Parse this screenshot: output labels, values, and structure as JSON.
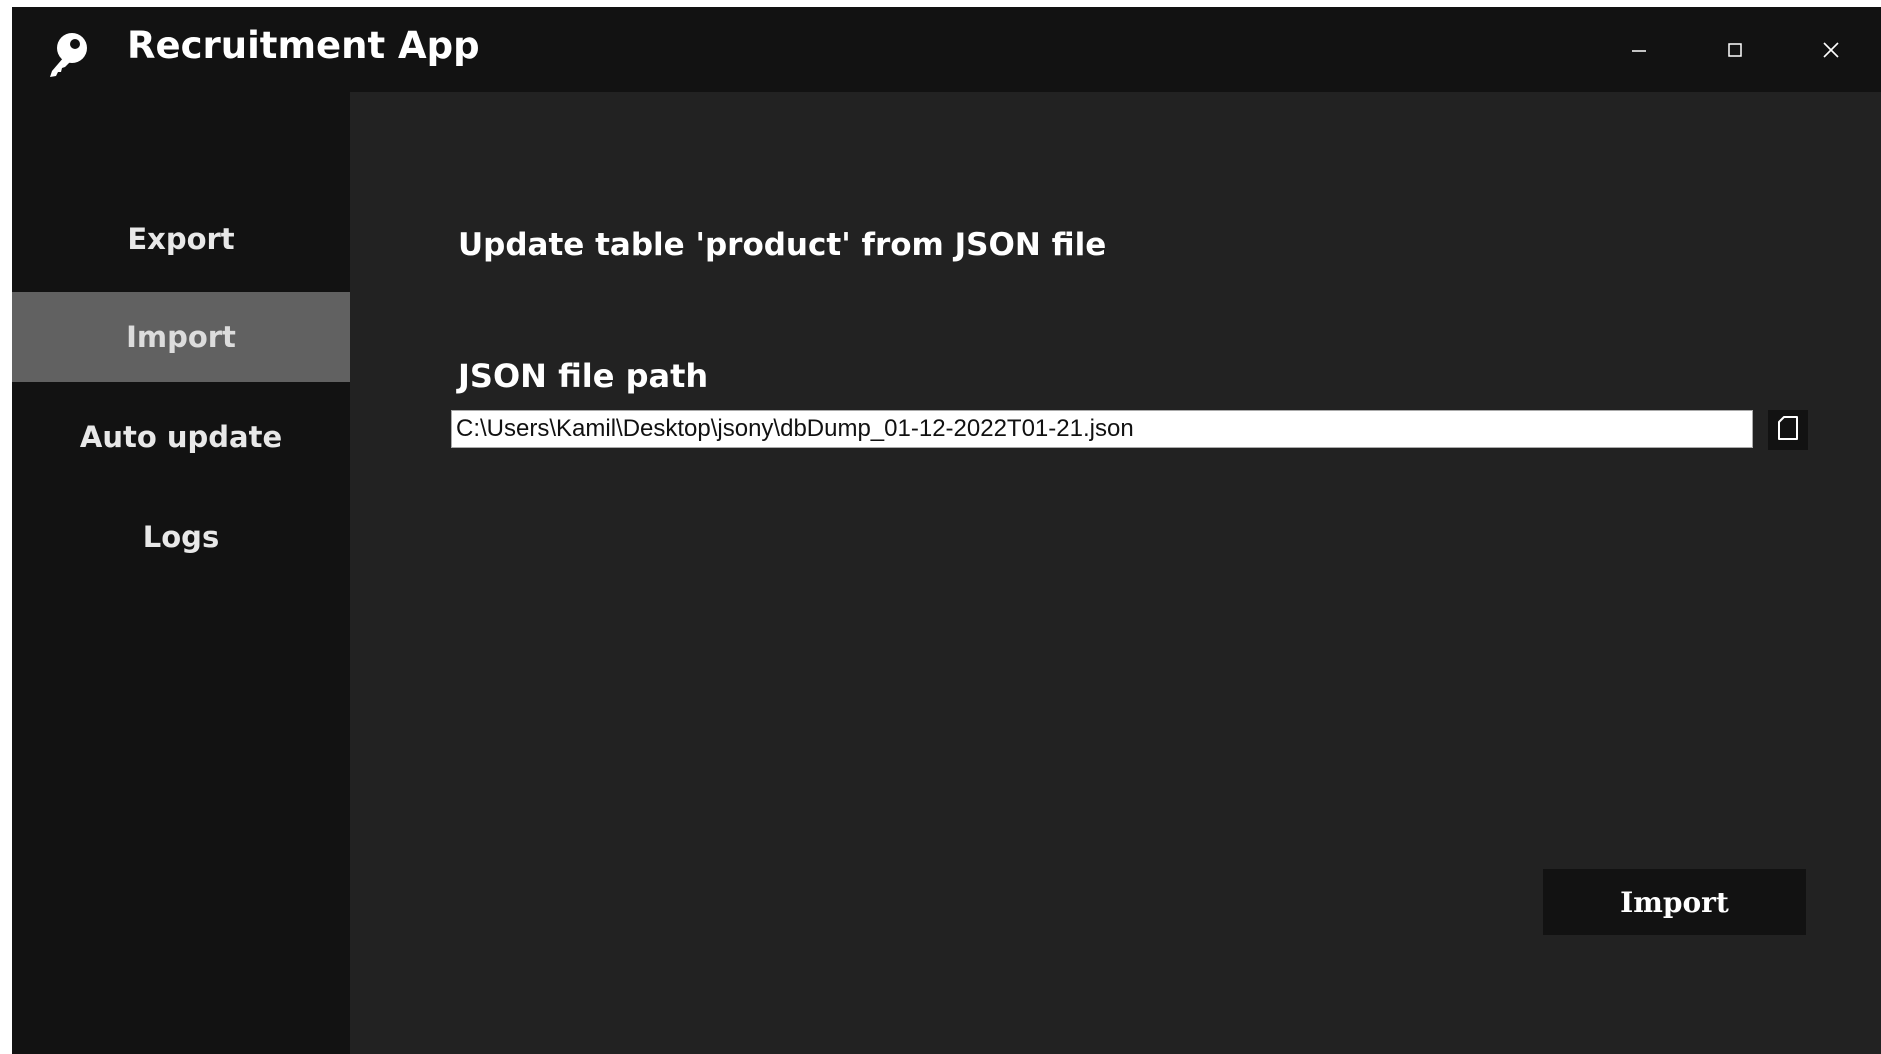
{
  "app": {
    "title": "Recruitment App",
    "icon": "key-icon"
  },
  "window_controls": {
    "minimize": "minimize-icon",
    "maximize": "maximize-icon",
    "close": "close-icon"
  },
  "sidebar": {
    "items": [
      {
        "label": "Export",
        "active": false
      },
      {
        "label": "Import",
        "active": true
      },
      {
        "label": "Auto update",
        "active": false
      },
      {
        "label": "Logs",
        "active": false
      }
    ]
  },
  "main": {
    "heading": "Update table 'product' from JSON file",
    "file_path_label": "JSON file path",
    "file_path_value": "C:\\Users\\Kamil\\Desktop\\jsony\\dbDump_01-12-2022T01-21.json",
    "browse_icon": "file-icon",
    "import_label": "Import"
  },
  "colors": {
    "titlebar_bg": "#121212",
    "sidebar_bg": "#121212",
    "content_bg": "#222222",
    "active_item_bg": "#616161",
    "text": "#ffffff"
  }
}
